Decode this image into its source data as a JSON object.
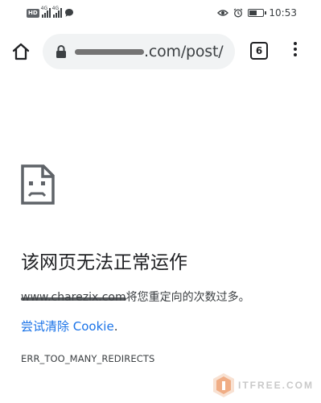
{
  "status_bar": {
    "hd_badge": "HD",
    "network_1": "4G",
    "network_2": "4G",
    "time": "10:53",
    "battery_level": 0.45
  },
  "toolbar": {
    "url_visible": ".com/post/",
    "tab_count": "6"
  },
  "error_page": {
    "title": "该网页无法正常运作",
    "domain": "www.charezix.com",
    "message": "将您重定向的次数过多。",
    "retry_link": "尝试清除 Cookie",
    "retry_suffix": ".",
    "error_code": "ERR_TOO_MANY_REDIRECTS"
  },
  "watermark": {
    "text": "ITFREE.COM"
  },
  "icons": {
    "home": "home-icon",
    "lock": "lock-icon",
    "tabs": "tab-switcher-icon",
    "menu": "more-vert-icon",
    "error": "sad-document-icon"
  }
}
